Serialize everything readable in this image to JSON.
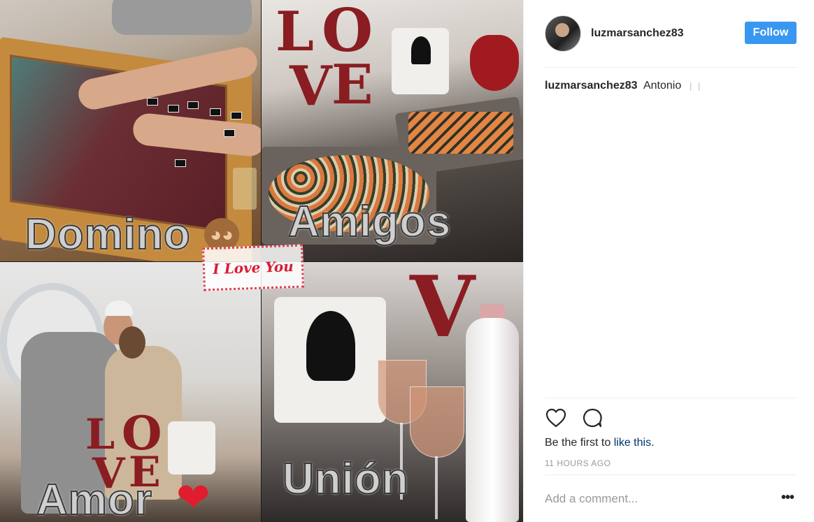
{
  "media": {
    "captions": {
      "domino": "Domino",
      "amigos": "Amigos",
      "amor": "Amor",
      "union": "Unión",
      "sticker": "I Love You"
    },
    "decor": {
      "love_top": [
        "L",
        "O",
        "V",
        "E"
      ],
      "love_bottom": [
        "L",
        "O",
        "V",
        "E"
      ]
    },
    "colors": {
      "love_red": "#8a1d22",
      "sticker_red": "#d81e33",
      "heart_red": "#e01d2e"
    },
    "icons": [
      "monkey-see-no-evil-icon",
      "red-heart-icon"
    ]
  },
  "post": {
    "author": "luzmarsanchez83",
    "follow_label": "Follow",
    "caption_user": "luzmarsanchez83",
    "caption_text": "Antonio",
    "caption_tail": "❘❘",
    "likes_prefix": "Be the first to ",
    "likes_link": "like this",
    "likes_suffix": ".",
    "timestamp": "11 HOURS AGO",
    "comment_placeholder": "Add a comment...",
    "more_label": "•••"
  },
  "colors": {
    "follow_blue": "#3897f0",
    "link_blue": "#003569",
    "muted": "#999999"
  }
}
